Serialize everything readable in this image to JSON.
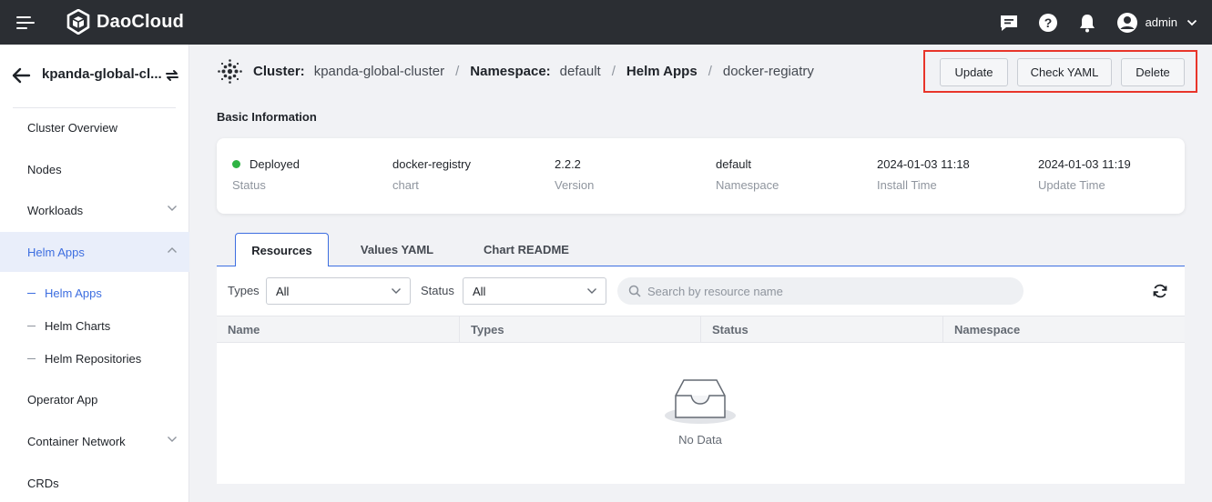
{
  "app": {
    "brand": "DaoCloud",
    "user_name": "admin",
    "icons": [
      "menu-icon",
      "daocloud-logo",
      "message-icon",
      "help-icon",
      "bell-icon",
      "user-icon",
      "chevron-down-icon"
    ]
  },
  "sidebar": {
    "cluster_name": "kpanda-global-cl...",
    "items": [
      {
        "label": "Cluster Overview"
      },
      {
        "label": "Nodes"
      },
      {
        "label": "Workloads"
      },
      {
        "label": "Helm Apps"
      },
      {
        "label": "Operator App"
      },
      {
        "label": "Container Network"
      },
      {
        "label": "CRDs"
      }
    ],
    "sub_items": [
      {
        "label": "Helm Apps"
      },
      {
        "label": "Helm Charts"
      },
      {
        "label": "Helm Repositories"
      }
    ],
    "active_item": "Helm Apps",
    "active_sub_item": "Helm Apps"
  },
  "breadcrumb": {
    "cluster_label": "Cluster:",
    "cluster_value": "kpanda-global-cluster",
    "namespace_label": "Namespace:",
    "namespace_value": "default",
    "section": "Helm Apps",
    "current": "docker-regiatry",
    "separator": "/"
  },
  "actions": {
    "update": "Update",
    "check_yaml": "Check YAML",
    "delete": "Delete",
    "highlight_color": "#e8352a"
  },
  "basic_info": {
    "title": "Basic Information",
    "fields": [
      {
        "value": "Deployed",
        "label": "Status"
      },
      {
        "value": "docker-registry",
        "label": "chart"
      },
      {
        "value": "2.2.2",
        "label": "Version"
      },
      {
        "value": "default",
        "label": "Namespace"
      },
      {
        "value": "2024-01-03 11:18",
        "label": "Install Time"
      },
      {
        "value": "2024-01-03 11:19",
        "label": "Update Time"
      }
    ],
    "status_color": "#2fb344"
  },
  "tabs": [
    {
      "label": "Resources",
      "active": true
    },
    {
      "label": "Values YAML",
      "active": false
    },
    {
      "label": "Chart README",
      "active": false
    }
  ],
  "filters": {
    "types_label": "Types",
    "types_value": "All",
    "status_label": "Status",
    "status_value": "All",
    "search_placeholder": "Search by resource name"
  },
  "table": {
    "columns": [
      "Name",
      "Types",
      "Status",
      "Namespace"
    ],
    "rows": [],
    "empty_text": "No Data"
  },
  "colors": {
    "topbar": "#2b2e33",
    "accent": "#3d6ee0",
    "background": "#f1f2f5"
  }
}
